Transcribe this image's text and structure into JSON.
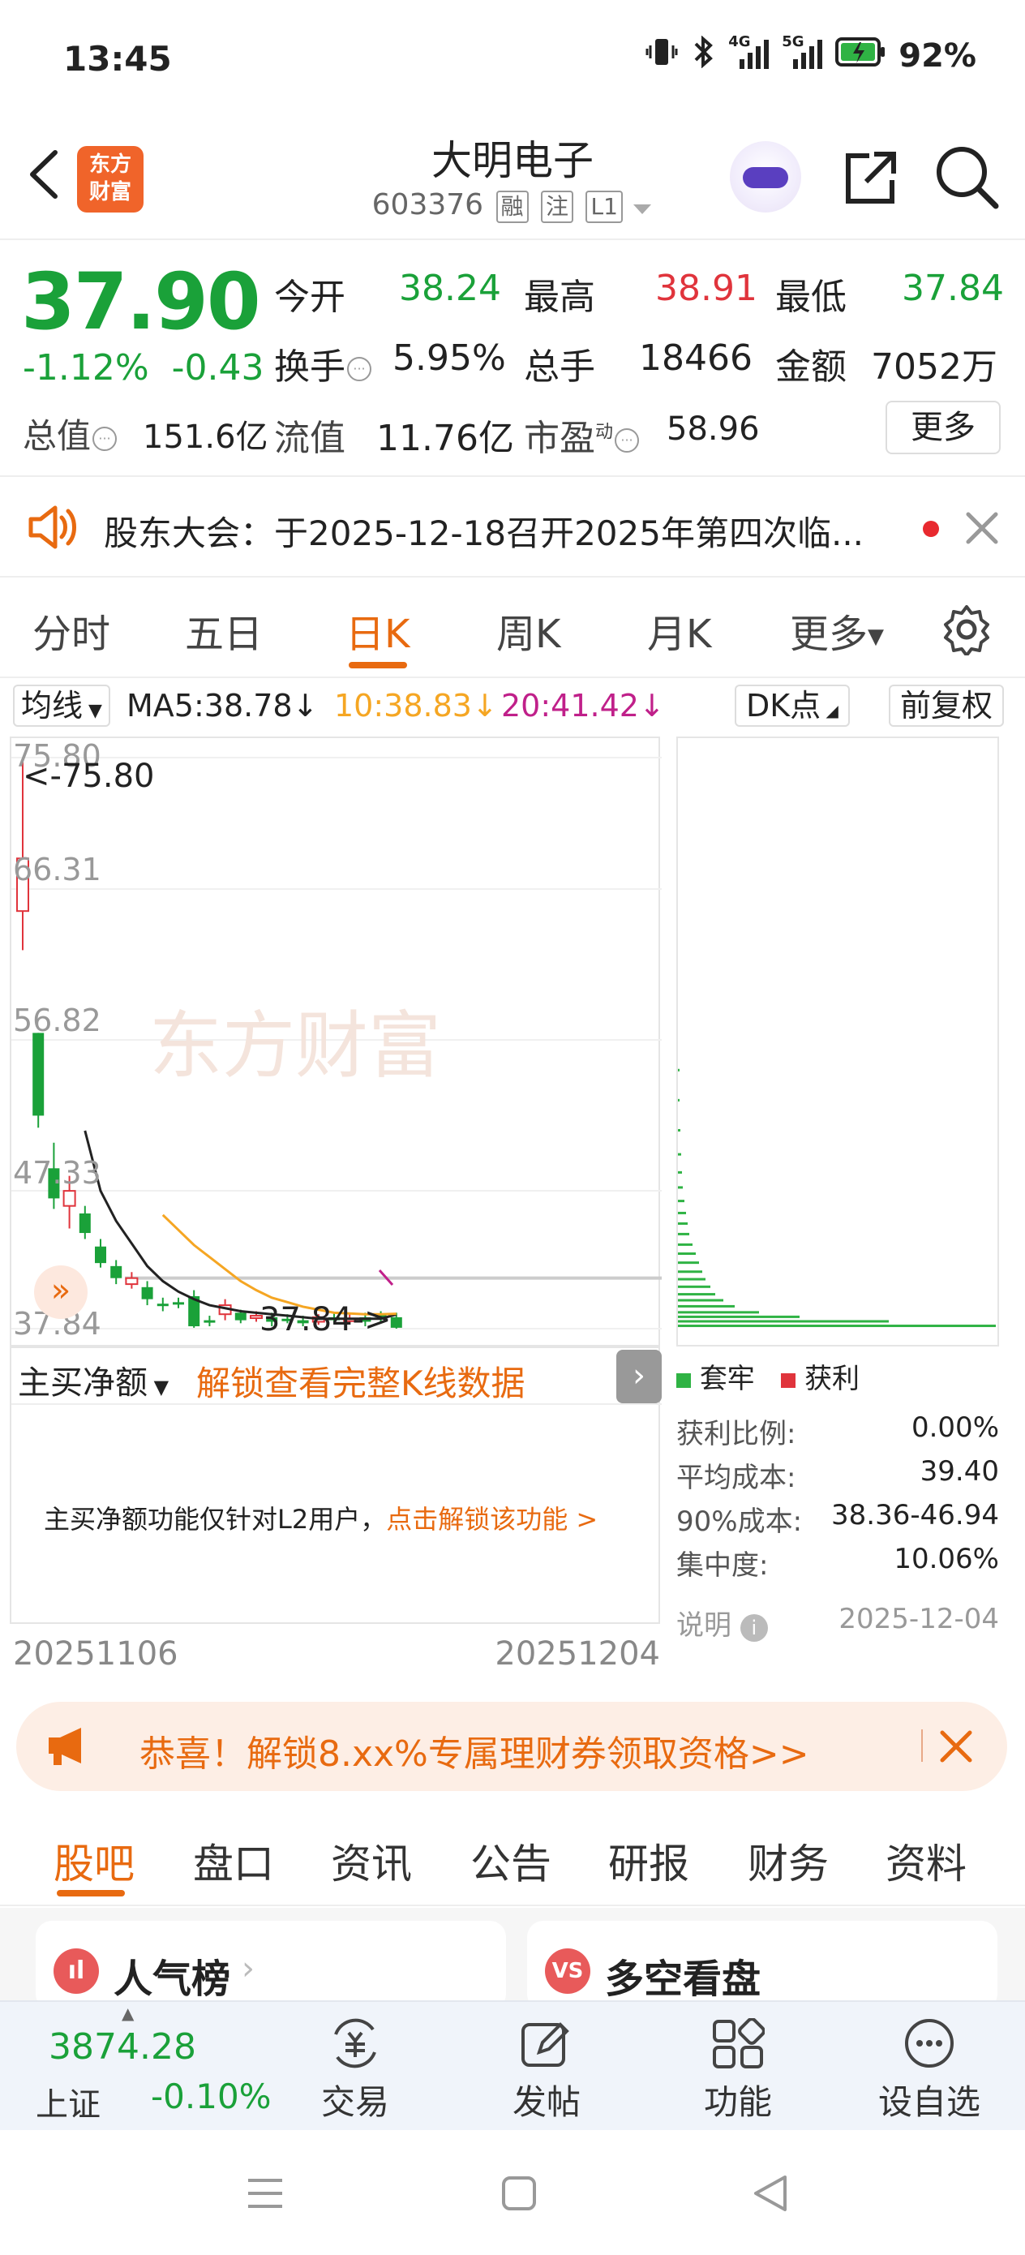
{
  "status_bar": {
    "time": "13:45",
    "battery": "92%",
    "net1": "4G",
    "net2": "5G"
  },
  "header": {
    "logo_text": "东方财富",
    "stock_name": "大明电子",
    "stock_code": "603376",
    "tags": [
      "融",
      "注",
      "L1"
    ]
  },
  "quote": {
    "price": "37.90",
    "change_pct": "-1.12%",
    "change": "-0.43",
    "fields": [
      {
        "label": "今开",
        "value": "38.24",
        "color": "green"
      },
      {
        "label": "最高",
        "value": "38.91",
        "color": "red"
      },
      {
        "label": "最低",
        "value": "37.84",
        "color": "green"
      },
      {
        "label": "换手",
        "value": "5.95%",
        "color": "black"
      },
      {
        "label": "总手",
        "value": "18466",
        "color": "black"
      },
      {
        "label": "金额",
        "value": "7052万",
        "color": "black"
      },
      {
        "label": "总值",
        "value": "151.6亿",
        "color": "black"
      },
      {
        "label": "流值",
        "value": "11.76亿",
        "color": "black"
      },
      {
        "label": "市盈",
        "value": "58.96",
        "color": "black"
      }
    ],
    "pe_sup": "动",
    "more_label": "更多"
  },
  "notice": {
    "text": "股东大会：于2025-12-18召开2025年第四次临..."
  },
  "chart_tabs": [
    "分时",
    "五日",
    "日K",
    "周K",
    "月K",
    "更多"
  ],
  "ma_row": {
    "selector": "均线",
    "ma5": "MA5:38.78",
    "ma10": "10:38.83",
    "ma20": "20:41.42",
    "dk": "DK点",
    "adjust": "前复权"
  },
  "chart_data": {
    "type": "candlestick",
    "price_axis_labels": [
      "75.80",
      "66.31",
      "56.82",
      "47.33",
      "37.84"
    ],
    "high_marker": "<-75.80",
    "low_marker": "37.84->",
    "ylim": [
      37.84,
      75.8
    ],
    "candles": [
      {
        "o": 65.6,
        "c": 69.1,
        "h": 75.8,
        "l": 63.0,
        "up": true
      },
      {
        "o": 57.5,
        "c": 52.0,
        "h": 57.5,
        "l": 51.2,
        "up": false
      },
      {
        "o": 48.5,
        "c": 46.5,
        "h": 50.2,
        "l": 45.8,
        "up": false
      },
      {
        "o": 46.0,
        "c": 47.0,
        "h": 48.0,
        "l": 44.5,
        "up": true
      },
      {
        "o": 45.5,
        "c": 44.2,
        "h": 46.0,
        "l": 43.8,
        "up": false
      },
      {
        "o": 43.3,
        "c": 42.2,
        "h": 43.8,
        "l": 41.9,
        "up": false
      },
      {
        "o": 42.0,
        "c": 41.2,
        "h": 42.4,
        "l": 40.8,
        "up": false
      },
      {
        "o": 40.8,
        "c": 41.2,
        "h": 41.6,
        "l": 40.5,
        "up": true
      },
      {
        "o": 40.6,
        "c": 39.8,
        "h": 41.0,
        "l": 39.4,
        "up": false
      },
      {
        "o": 39.5,
        "c": 39.5,
        "h": 39.9,
        "l": 39.0,
        "up": false
      },
      {
        "o": 39.6,
        "c": 39.6,
        "h": 39.9,
        "l": 39.2,
        "up": false
      },
      {
        "o": 40.0,
        "c": 38.0,
        "h": 40.4,
        "l": 37.9,
        "up": false
      },
      {
        "o": 38.4,
        "c": 38.4,
        "h": 38.7,
        "l": 38.0,
        "up": false
      },
      {
        "o": 38.8,
        "c": 39.4,
        "h": 39.8,
        "l": 38.4,
        "up": true
      },
      {
        "o": 38.9,
        "c": 38.4,
        "h": 39.1,
        "l": 38.2,
        "up": false
      },
      {
        "o": 38.7,
        "c": 38.7,
        "h": 39.0,
        "l": 38.3,
        "up": true
      },
      {
        "o": 38.6,
        "c": 38.3,
        "h": 38.9,
        "l": 38.0,
        "up": false
      },
      {
        "o": 38.5,
        "c": 38.5,
        "h": 38.8,
        "l": 38.2,
        "up": false
      },
      {
        "o": 38.4,
        "c": 38.2,
        "h": 38.7,
        "l": 38.0,
        "up": false
      },
      {
        "o": 38.3,
        "c": 38.6,
        "h": 38.8,
        "l": 38.1,
        "up": true
      },
      {
        "o": 38.6,
        "c": 38.4,
        "h": 38.9,
        "l": 38.2,
        "up": false
      },
      {
        "o": 38.4,
        "c": 38.5,
        "h": 38.8,
        "l": 38.2,
        "up": true
      },
      {
        "o": 38.6,
        "c": 38.3,
        "h": 38.9,
        "l": 38.0,
        "up": false
      },
      {
        "o": 38.8,
        "c": 38.6,
        "h": 39.0,
        "l": 38.3,
        "up": false
      },
      {
        "o": 38.6,
        "c": 37.9,
        "h": 38.9,
        "l": 37.84,
        "up": false
      }
    ],
    "ma5": [
      null,
      null,
      null,
      null,
      51.0,
      47.0,
      45.0,
      43.5,
      42.0,
      41.0,
      40.3,
      39.8,
      39.4,
      39.2,
      39.0,
      38.9,
      38.8,
      38.7,
      38.6,
      38.5,
      38.5,
      38.5,
      38.5,
      38.5,
      38.78
    ],
    "ma10": [
      null,
      null,
      null,
      null,
      null,
      null,
      null,
      null,
      null,
      45.4,
      44.4,
      43.4,
      42.6,
      41.8,
      41.0,
      40.4,
      39.9,
      39.6,
      39.3,
      39.1,
      38.9,
      38.85,
      38.8,
      38.8,
      38.83
    ]
  },
  "net_panel": {
    "selector": "主买净额",
    "unlock": "解锁查看完整K线数据",
    "msg": "主买净额功能仅针对L2用户，",
    "msg_link": "点击解锁该功能 >"
  },
  "dates": {
    "start": "20251106",
    "end": "20251204"
  },
  "dist_legend": {
    "trapped": "套牢",
    "profit": "获利"
  },
  "stats": [
    {
      "k": "获利比例:",
      "v": "0.00%"
    },
    {
      "k": "平均成本:",
      "v": "39.40"
    },
    {
      "k": "90%成本:",
      "v": "38.36-46.94"
    },
    {
      "k": "集中度:",
      "v": "10.06%"
    }
  ],
  "note": {
    "label": "说明",
    "date": "2025-12-04"
  },
  "promo": {
    "text": "恭喜！解锁8.xx%专属理财券领取资格>>"
  },
  "bottom_tabs": [
    "股吧",
    "盘口",
    "资讯",
    "公告",
    "研报",
    "财务",
    "资料"
  ],
  "cards": [
    {
      "label": "人气榜",
      "icon": "ill"
    },
    {
      "label": "多空看盘",
      "icon": "VS"
    }
  ],
  "bottom_nav": {
    "index_value": "3874.28",
    "index_name": "上证",
    "index_change": "-0.10%",
    "items": [
      "交易",
      "发帖",
      "功能",
      "设自选"
    ]
  },
  "colors": {
    "up": "#e0343c",
    "down": "#1aa139",
    "accent": "#e86a10",
    "ma10": "#f5a623",
    "ma20": "#c0208a"
  }
}
